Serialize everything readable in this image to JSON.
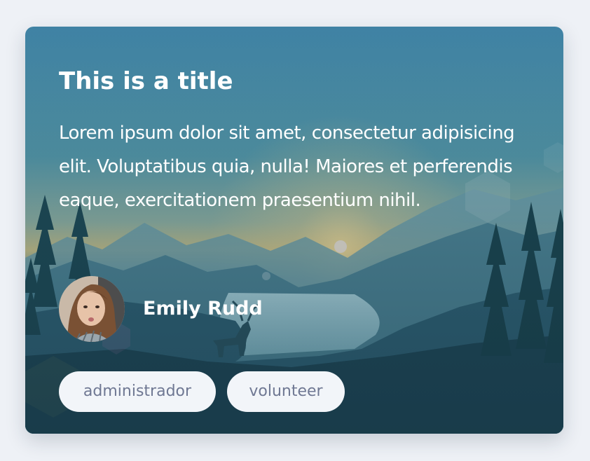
{
  "card": {
    "title": "This is a title",
    "body": "Lorem ipsum dolor sit amet, consectetur adipisicing elit. Voluptatibus quia, nulla! Maiores et perferendis eaque, exercitationem praesentium nihil.",
    "author": {
      "name": "Emily Rudd"
    },
    "tags": [
      "administrador",
      "volunteer"
    ]
  },
  "colors": {
    "page_background": "#eef1f6",
    "tag_background": "#f2f5f9",
    "tag_text": "#6f7893",
    "title_text": "#ffffff"
  },
  "icons": {
    "background_image": "mountain-lake-landscape-image",
    "avatar_image": "emily-rudd-avatar"
  }
}
